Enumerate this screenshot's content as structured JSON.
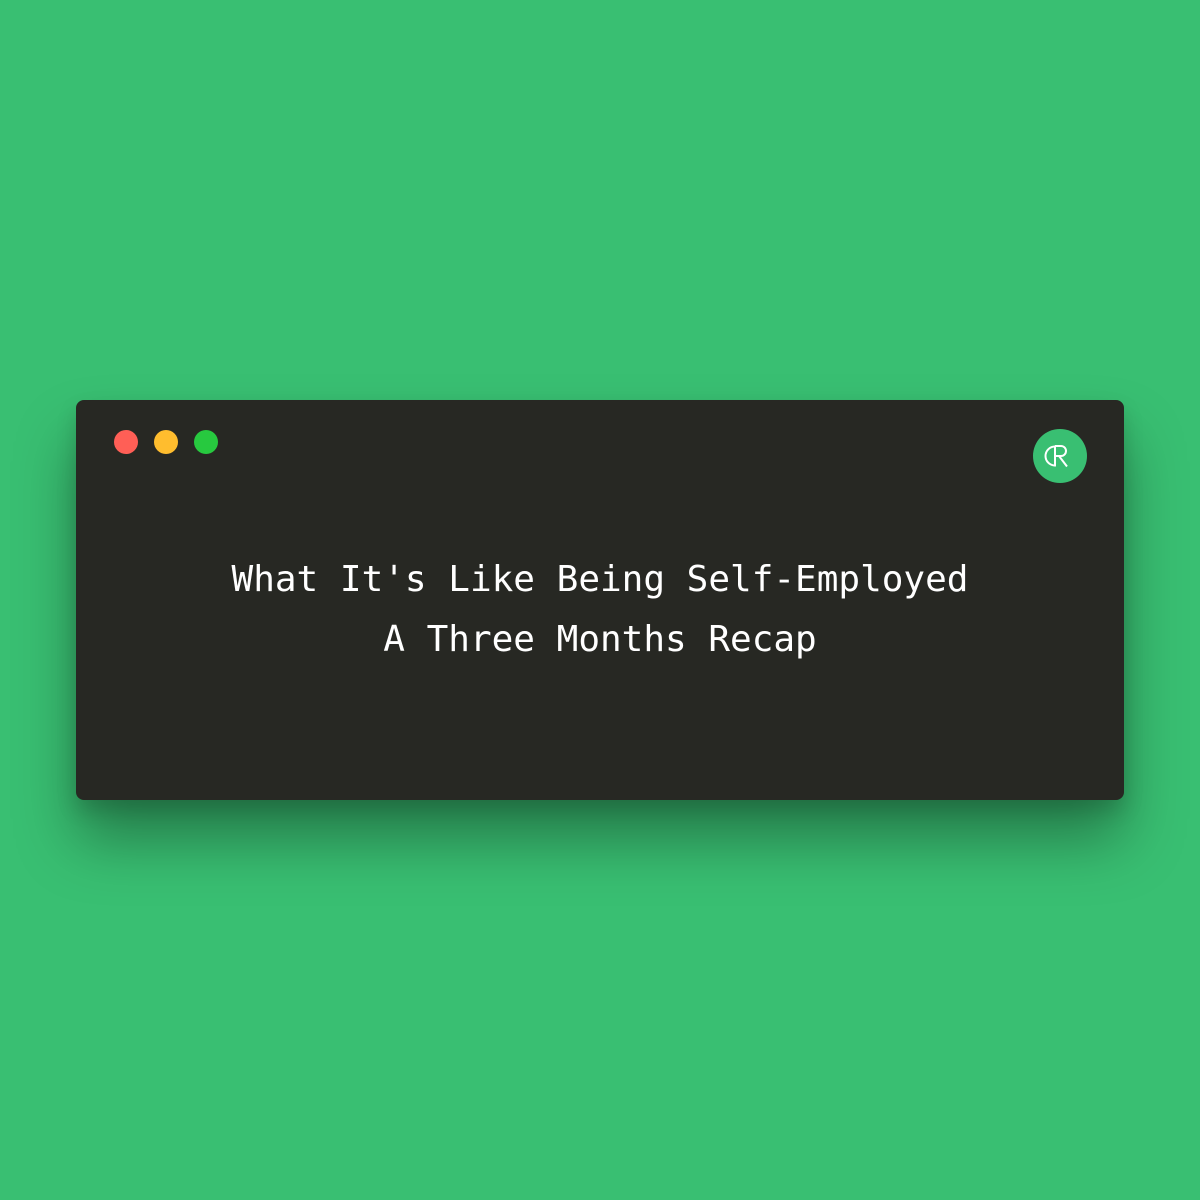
{
  "colors": {
    "background": "#39bf72",
    "window": "#272823",
    "close": "#ff5f56",
    "minimize": "#ffbd2e",
    "maximize": "#27c93f",
    "text": "#ffffff"
  },
  "window_controls": [
    "close",
    "minimize",
    "maximize"
  ],
  "logo": {
    "icon": "cr-monogram-logo",
    "text": "CR"
  },
  "heading": {
    "line1": "What It's Like Being Self-Employed",
    "line2": "A Three Months Recap"
  }
}
